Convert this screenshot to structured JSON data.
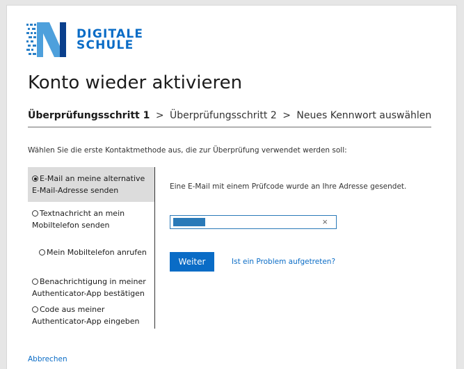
{
  "brand": {
    "line1": "DIGITALE",
    "line2": "SCHULE",
    "logo_icon": "circuit-letter-n-logo-icon",
    "color": "#0a6cc6"
  },
  "title": "Konto wieder aktivieren",
  "steps": {
    "step1": "Überprüfungsschritt 1",
    "sep": ">",
    "step2": "Überprüfungsschritt 2",
    "step3": "Neues Kennwort auswählen"
  },
  "intro": "Wählen Sie die erste Kontaktmethode aus, die zur Überprüfung verwendet werden soll:",
  "methods": [
    {
      "label": "E-Mail an meine alternative E-Mail-Adresse senden",
      "selected": true
    },
    {
      "label": "Textnachricht an mein Mobiltelefon senden",
      "selected": false
    },
    {
      "label": "Mein Mobiltelefon anrufen",
      "selected": false
    },
    {
      "label": "Benachrichtigung in meiner Authenticator-App bestätigen",
      "selected": false
    },
    {
      "label": "Code aus meiner Authenticator-App eingeben",
      "selected": false
    }
  ],
  "status": "Eine E-Mail mit einem Prüfcode wurde an Ihre Adresse gesendet.",
  "code_input": {
    "value": "",
    "clear_icon": "×"
  },
  "next_button": "Weiter",
  "problem_link": "Ist ein Problem aufgetreten?",
  "cancel_link": "Abbrechen",
  "colors": {
    "accent": "#0a6cc6",
    "selected_bg": "#dcdcdc"
  }
}
